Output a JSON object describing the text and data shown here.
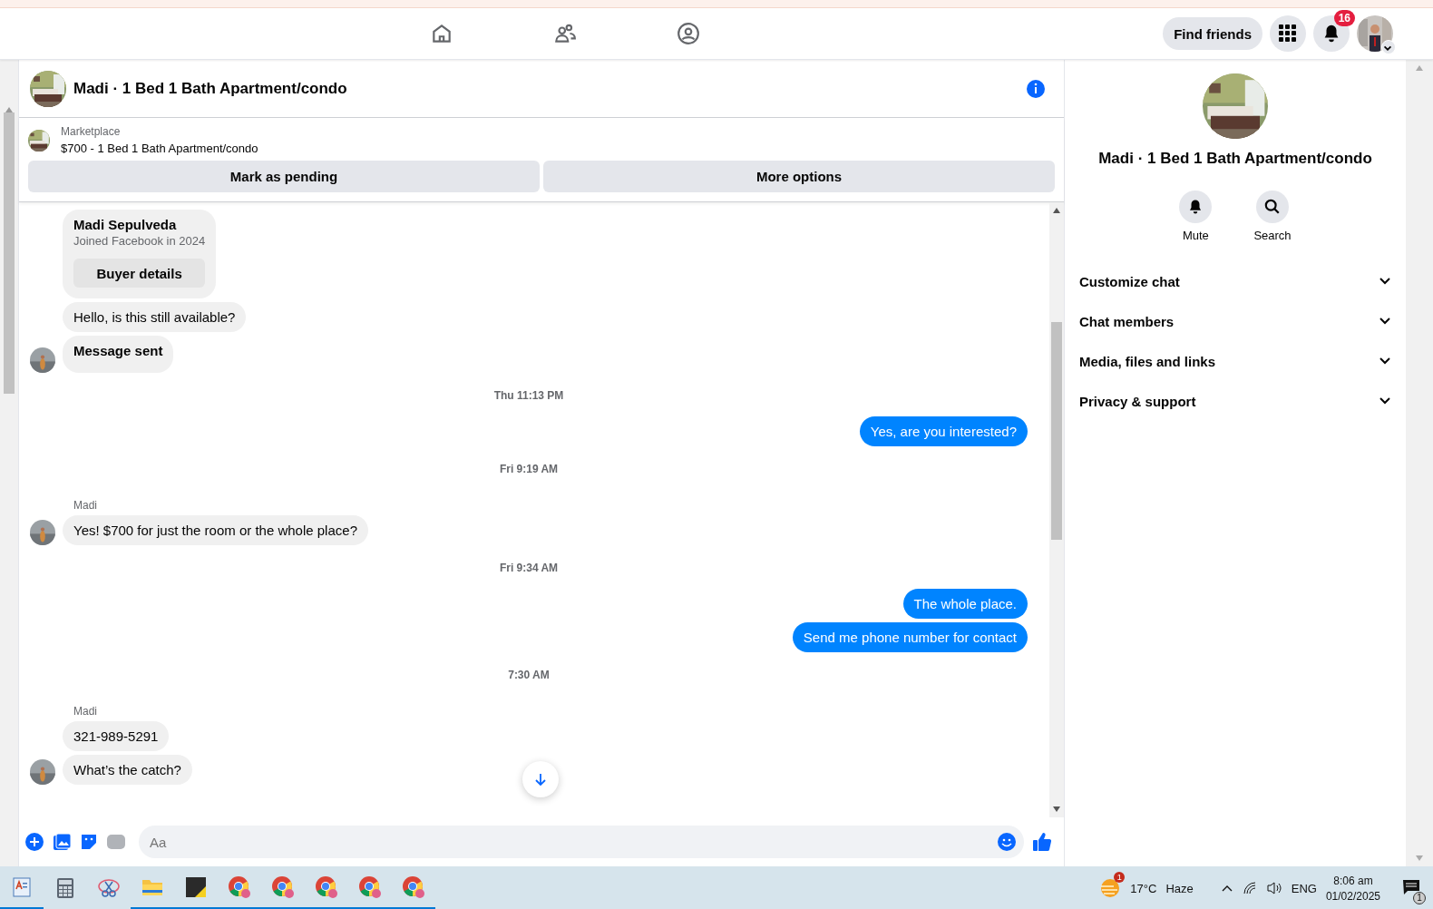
{
  "top_bar": {
    "find_friends": "Find friends",
    "notification_count": "16",
    "nav": [
      {
        "kind": "home",
        "selected": false
      },
      {
        "kind": "friends",
        "selected": false
      },
      {
        "kind": "groups",
        "selected": false
      }
    ]
  },
  "chat": {
    "title": "Madi · 1 Bed 1 Bath Apartment/condo",
    "listing": {
      "source": "Marketplace",
      "title": "$700 - 1 Bed 1 Bath Apartment/condo",
      "buttons": [
        "Mark as pending",
        "More options"
      ]
    },
    "messages": [
      {
        "kind": "card",
        "name": "Madi Sepulveda",
        "subtitle": "Joined Facebook in 2024",
        "button": "Buyer details"
      },
      {
        "kind": "incoming",
        "text": "Hello, is this still available?",
        "avatar": false
      },
      {
        "kind": "notice",
        "text": "Message sent",
        "avatar": true
      },
      {
        "kind": "time",
        "text": "Thu 11:13 PM"
      },
      {
        "kind": "outgoing",
        "text": "Yes, are you interested?"
      },
      {
        "kind": "time",
        "text": "Fri 9:19 AM"
      },
      {
        "kind": "sender",
        "text": "Madi"
      },
      {
        "kind": "incoming",
        "text": "Yes! $700 for just the room or the whole place?",
        "avatar": true
      },
      {
        "kind": "time",
        "text": "Fri 9:34 AM"
      },
      {
        "kind": "outgoing",
        "text": "The whole place."
      },
      {
        "kind": "outgoing",
        "text": "Send me phone number for contact"
      },
      {
        "kind": "time",
        "text": "7:30 AM"
      },
      {
        "kind": "sender",
        "text": "Madi"
      },
      {
        "kind": "incoming",
        "text": "321-989-5291",
        "avatar": false
      },
      {
        "kind": "incoming",
        "text": "What’s the catch?",
        "avatar": true
      }
    ],
    "composer": {
      "placeholder": "Aa"
    }
  },
  "details": {
    "title": "Madi · 1 Bed 1 Bath Apartment/condo",
    "actions": [
      {
        "kind": "mute",
        "label": "Mute"
      },
      {
        "kind": "search",
        "label": "Search"
      }
    ],
    "sections": [
      {
        "label": "Customize chat",
        "expanded": false
      },
      {
        "label": "Chat members",
        "expanded": false
      },
      {
        "label": "Media, files and links",
        "expanded": false
      },
      {
        "label": "Privacy & support",
        "expanded": false
      }
    ]
  },
  "taskbar": {
    "apps": [
      {
        "kind": "wordpad",
        "running": true
      },
      {
        "kind": "calculator",
        "running": false
      },
      {
        "kind": "snip",
        "running": false
      },
      {
        "kind": "explorer",
        "running": true
      },
      {
        "kind": "notes",
        "running": true
      },
      {
        "kind": "chrome",
        "running": true
      },
      {
        "kind": "chrome",
        "running": true
      },
      {
        "kind": "chrome",
        "running": true
      },
      {
        "kind": "chrome",
        "running": true
      },
      {
        "kind": "chrome",
        "running": true
      }
    ],
    "weather_badge": "1",
    "temperature": "17°C",
    "weather": "Haze",
    "language": "ENG",
    "time": "8:06 am",
    "date": "01/02/2025",
    "notification_count": "1"
  }
}
